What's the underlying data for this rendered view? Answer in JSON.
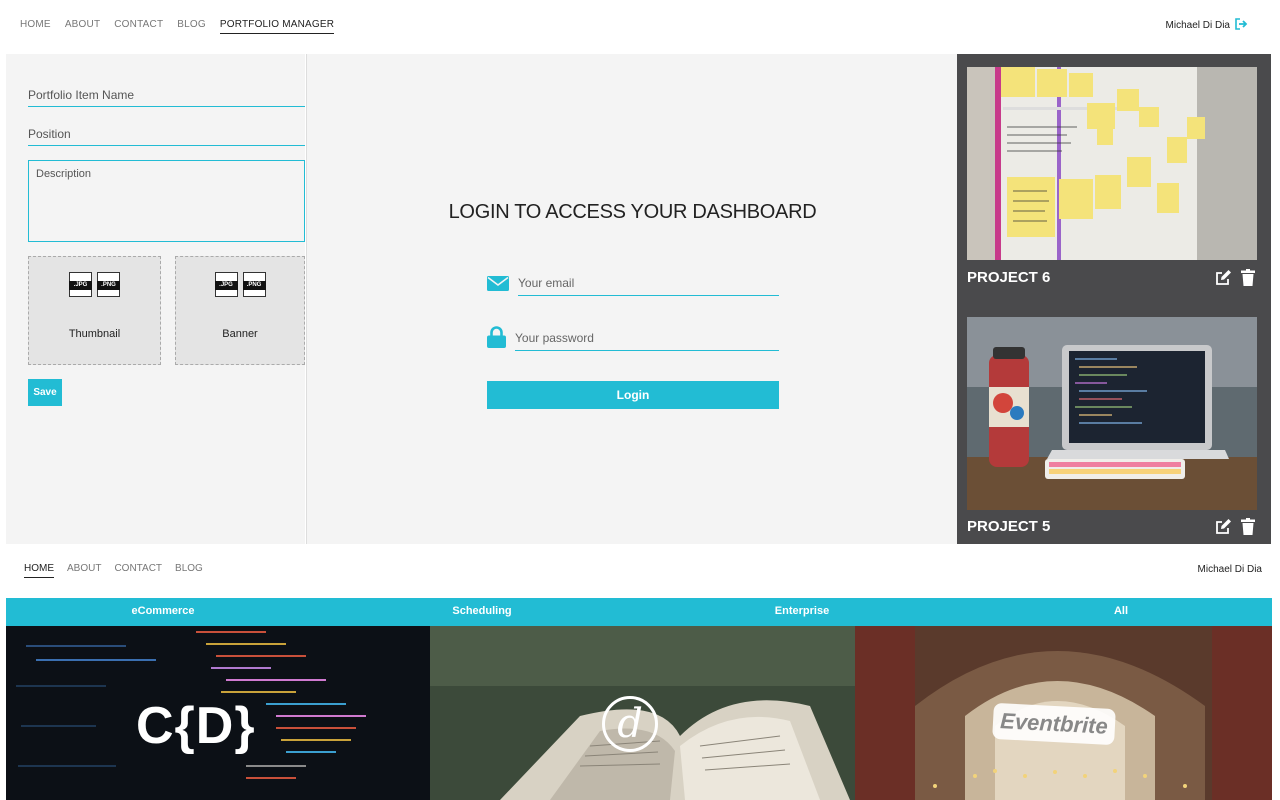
{
  "top_nav": {
    "links": [
      "HOME",
      "ABOUT",
      "CONTACT",
      "BLOG",
      "PORTFOLIO MANAGER"
    ],
    "active_index": 4,
    "user_name": "Michael Di Dia"
  },
  "portfolio_form": {
    "name_placeholder": "Portfolio Item Name",
    "position_placeholder": "Position",
    "description_placeholder": "Description",
    "file_types": [
      ".JPG",
      ".PNG"
    ],
    "thumbnail_label": "Thumbnail",
    "banner_label": "Banner",
    "save_label": "Save"
  },
  "login": {
    "title": "LOGIN TO ACCESS YOUR DASHBOARD",
    "email_placeholder": "Your email",
    "password_placeholder": "Your password",
    "button_label": "Login"
  },
  "projects": [
    {
      "title": "PROJECT 6"
    },
    {
      "title": "PROJECT 5"
    }
  ],
  "site_nav": {
    "links": [
      "HOME",
      "ABOUT",
      "CONTACT",
      "BLOG"
    ],
    "active_index": 0,
    "user_name": "Michael Di Dia"
  },
  "categories": [
    "eCommerce",
    "Scheduling",
    "Enterprise",
    "All"
  ],
  "tiles": [
    {
      "logo_text": "C{D}"
    },
    {
      "logo_text": "d"
    },
    {
      "logo_text": "Eventbrite"
    }
  ],
  "colors": {
    "accent": "#22bcd4",
    "panel": "#f4f4f4",
    "projects_bg": "#4a4a4c"
  }
}
